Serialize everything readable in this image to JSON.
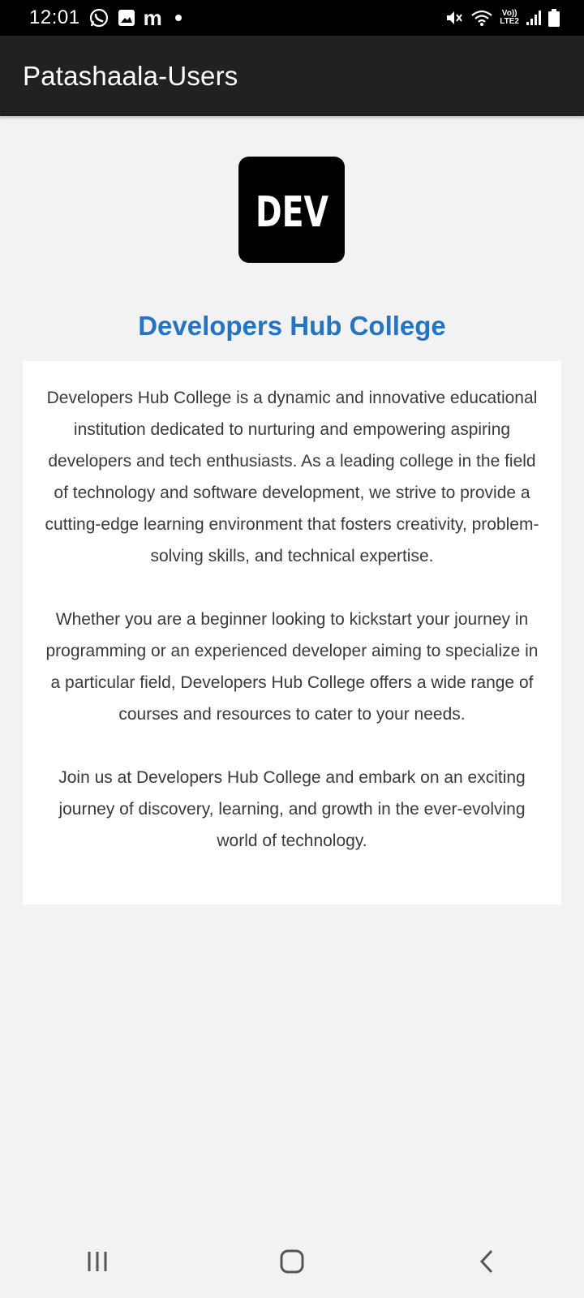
{
  "status_bar": {
    "time": "12:01",
    "m_label": "m",
    "volte_top": "Vo))",
    "volte_bottom": "LTE2",
    "icons": [
      "whatsapp-icon",
      "gallery-icon",
      "m-icon",
      "dot-icon",
      "mute-icon",
      "wifi-icon",
      "volte-icon",
      "signal-icon",
      "battery-icon"
    ]
  },
  "app_bar": {
    "title": "Patashaala-Users"
  },
  "logo": {
    "text": "DEV"
  },
  "college": {
    "name": "Developers Hub College",
    "paragraphs": [
      "Developers Hub College is a dynamic and innovative educational institution dedicated to nurturing and empowering aspiring developers and tech enthusiasts. As a leading college in the field of technology and software development, we strive to provide a cutting-edge learning environment that fosters creativity, problem-solving skills, and technical expertise.",
      "Whether you are a beginner looking to kickstart your journey in programming or an experienced developer aiming to specialize in a particular field, Developers Hub College offers a wide range of courses and resources to cater to your needs.",
      "Join us at Developers Hub College and embark on an exciting journey of discovery, learning, and growth in the ever-evolving world of technology."
    ]
  },
  "nav_bar": {
    "buttons": [
      "recent-apps",
      "home",
      "back"
    ]
  },
  "colors": {
    "accent": "#2574c2",
    "app_bar": "#212121",
    "background": "#f2f2f2"
  }
}
